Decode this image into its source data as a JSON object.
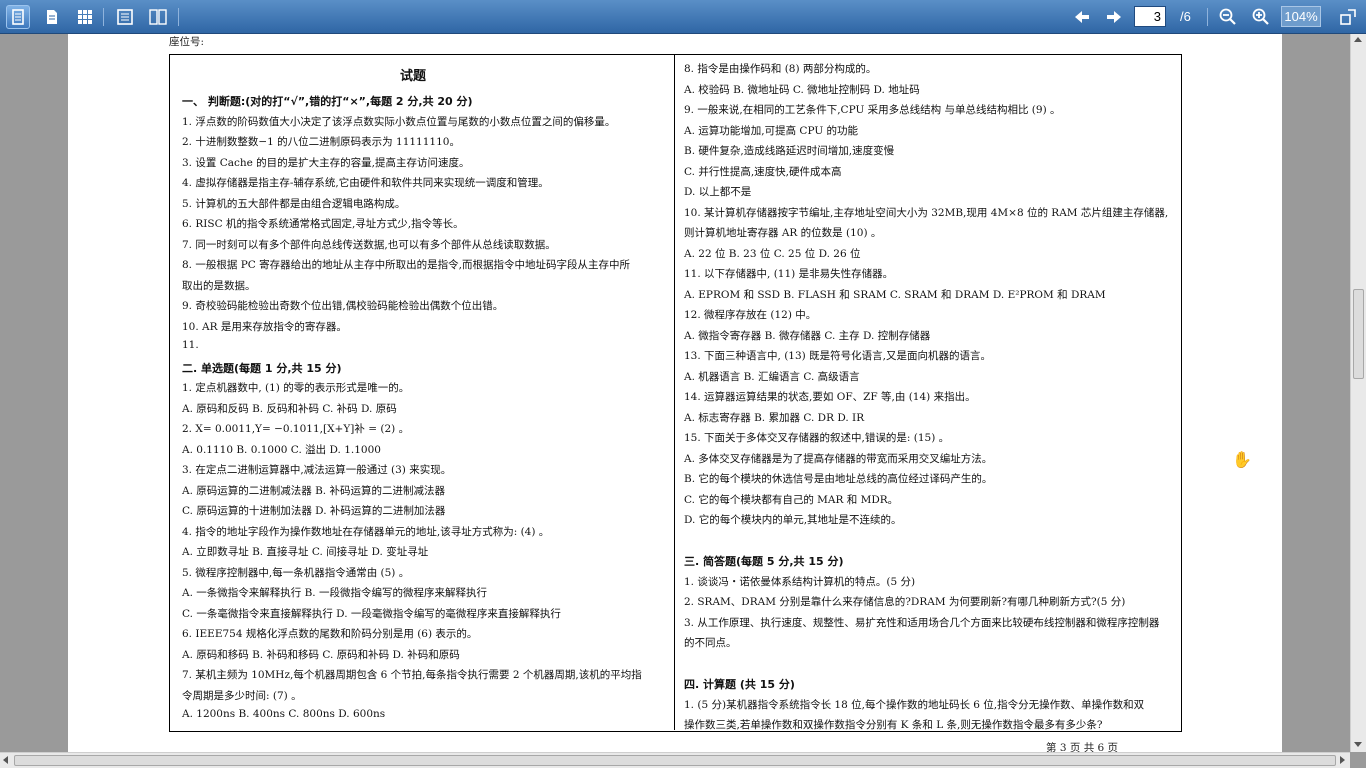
{
  "toolbar": {
    "page_current": "3",
    "page_total": "/6",
    "zoom": "104%"
  },
  "doc": {
    "seat_label": "座位号:",
    "title": "试题",
    "left": [
      {
        "t": "一、  判断题:(对的打“√”,错的打“×”,每题 2 分,共 20 分)",
        "sec": true
      },
      {
        "t": "1.   浮点数的阶码数值大小决定了该浮点数实际小数点位置与尾数的小数点位置之间的偏移量。"
      },
      {
        "t": "2.   十进制数整数−1 的八位二进制原码表示为 11111110。"
      },
      {
        "t": "3.   设置 Cache 的目的是扩大主存的容量,提高主存访问速度。"
      },
      {
        "t": "4.   虚拟存储器是指主存-辅存系统,它由硬件和软件共同来实现统一调度和管理。"
      },
      {
        "t": "5.   计算机的五大部件都是由组合逻辑电路构成。"
      },
      {
        "t": "6.   RISC 机的指令系统通常格式固定,寻址方式少,指令等长。"
      },
      {
        "t": "7.   同一时刻可以有多个部件向总线传送数据,也可以有多个部件从总线读取数据。"
      },
      {
        "t": "8.   一般根据 PC 寄存器给出的地址从主存中所取出的是指令,而根据指令中地址码字段从主存中所"
      },
      {
        "t": "      取出的是数据。"
      },
      {
        "t": "9.   奇校验码能检验出奇数个位出错,偶校验码能检验出偶数个位出错。"
      },
      {
        "t": "10.  AR 是用来存放指令的寄存器。"
      },
      {
        "t": "11."
      },
      {
        "t": "二.  单选题(每题 1 分,共 15 分)",
        "sec": true
      },
      {
        "t": "1.  定点机器数中,  (1)  的零的表示形式是唯一的。"
      },
      {
        "t": "      A.  原码和反码        B.  反码和补码            C.  补码             D.  原码"
      },
      {
        "t": "2.  X= 0.0011,Y= −0.1011,[X+Y]补  =  (2)  。"
      },
      {
        "t": "      A.  0.1110              B.  0.1000               C.  溢出             D.  1.1000"
      },
      {
        "t": "3.  在定点二进制运算器中,减法运算一般通过   (3)   来实现。"
      },
      {
        "t": "      A.  原码运算的二进制减法器        B.  补码运算的二进制减法器"
      },
      {
        "t": "      C.  原码运算的十进制加法器        D.  补码运算的二进制加法器"
      },
      {
        "t": "4.  指令的地址字段作为操作数地址在存储器单元的地址,该寻址方式称为:  (4)  。"
      },
      {
        "t": "      A.  立即数寻址     B.  直接寻址     C.  间接寻址     D.  变址寻址"
      },
      {
        "t": "5.  微程序控制器中,每一条机器指令通常由  (5)  。"
      },
      {
        "t": "       A.  一条微指令来解释执行               B.  一段微指令编写的微程序来解释执行"
      },
      {
        "t": "       C.  一条毫微指令来直接解释执行         D.  一段毫微指令编写的毫微程序来直接解释执行"
      },
      {
        "t": "6.  IEEE754 规格化浮点数的尾数和阶码分别是用  (6)  表示的。"
      },
      {
        "t": "        A.  原码和移码         B.  补码和移码             C.  原码和补码              D.  补码和原码"
      },
      {
        "t": "7.  某机主频为 10MHz,每个机器周期包含 6 个节拍,每条指令执行需要 2 个机器周期,该机的平均指"
      },
      {
        "t": "      令周期是多少时间:  (7)  。"
      },
      {
        "t": "        A.  1200ns            B.  400ns             C.  800ns             D.  600ns"
      }
    ],
    "right": [
      {
        "t": "8.  指令是由操作码和  (8)  两部分构成的。"
      },
      {
        "t": "      A.  校验码            B.  微地址码              C.  微地址控制码             D.  地址码"
      },
      {
        "t": "9.  一般来说,在相同的工艺条件下,CPU 采用多总线结构 与单总线结构相比  (9)  。"
      },
      {
        "t": "      A.  运算功能增加,可提高 CPU 的功能"
      },
      {
        "t": "      B.  硬件复杂,造成线路延迟时间增加,速度变慢"
      },
      {
        "t": "      C.  并行性提高,速度快,硬件成本高"
      },
      {
        "t": "      D.  以上都不是"
      },
      {
        "t": "10.  某计算机存储器按字节编址,主存地址空间大小为 32MB,现用 4M×8 位的 RAM 芯片组建主存储器,"
      },
      {
        "t": "      则计算机地址寄存器 AR 的位数是  (10)  。"
      },
      {
        "t": "   A.  22 位                B.  23 位                  C.  25 位          D.  26 位"
      },
      {
        "t": "11.  以下存储器中,  (11)  是非易失性存储器。"
      },
      {
        "t": "   A.  EPROM 和 SSD      B.  FLASH 和 SRAM      C.  SRAM 和 DRAM      D.  E²PROM 和 DRAM"
      },
      {
        "t": "12.  微程序存放在  (12)  中。"
      },
      {
        "t": "    A.  微指令寄存器              B.  微存储器             C.  主存               D.  控制存储器"
      },
      {
        "t": "13.  下面三种语言中,  (13)  既是符号化语言,又是面向机器的语言。"
      },
      {
        "t": "    A.  机器语言                        B.  汇编语言                        C.  高级语言"
      },
      {
        "t": "14.  运算器运算结果的状态,要如 OF、ZF 等,由  (14)  来指出。"
      },
      {
        "t": "    A.  标志寄存器           B.  累加器               C.  DR              D.  IR"
      },
      {
        "t": "15.  下面关于多体交叉存储器的叙述中,错误的是:  (15)  。"
      },
      {
        "t": "    A.  多体交叉存储器是为了提高存储器的带宽而采用交叉编址方法。"
      },
      {
        "t": "    B.  它的每个模块的休选信号是由地址总线的高位经过译码产生的。"
      },
      {
        "t": "    C.  它的每个模块都有自己的 MAR 和 MDR。"
      },
      {
        "t": "    D.  它的每个模块内的单元,其地址是不连续的。"
      },
      {
        "t": ""
      },
      {
        "t": "三.  简答题(每题 5 分,共 15 分)",
        "sec": true
      },
      {
        "t": "1.   谈谈冯・诺依曼体系结构计算机的特点。(5 分)"
      },
      {
        "t": "2.   SRAM、DRAM 分别是靠什么来存储信息的?DRAM 为何要刷新?有哪几种刷新方式?(5 分)"
      },
      {
        "t": "3.   从工作原理、执行速度、规整性、易扩充性和适用场合几个方面来比较硬布线控制器和微程序控制器"
      },
      {
        "t": "      的不同点。"
      },
      {
        "t": ""
      },
      {
        "t": "四.  计算题  (共 15 分)",
        "sec": true
      },
      {
        "t": "1.  (5 分)某机器指令系统指令长 18 位,每个操作数的地址码长 6 位,指令分无操作数、单操作数和双"
      },
      {
        "t": "      操作数三类,若单操作数和双操作数指令分别有 K 条和 L 条,则无操作数指令最多有多少条?"
      }
    ],
    "footer": "第  3  页          共  6  页"
  }
}
